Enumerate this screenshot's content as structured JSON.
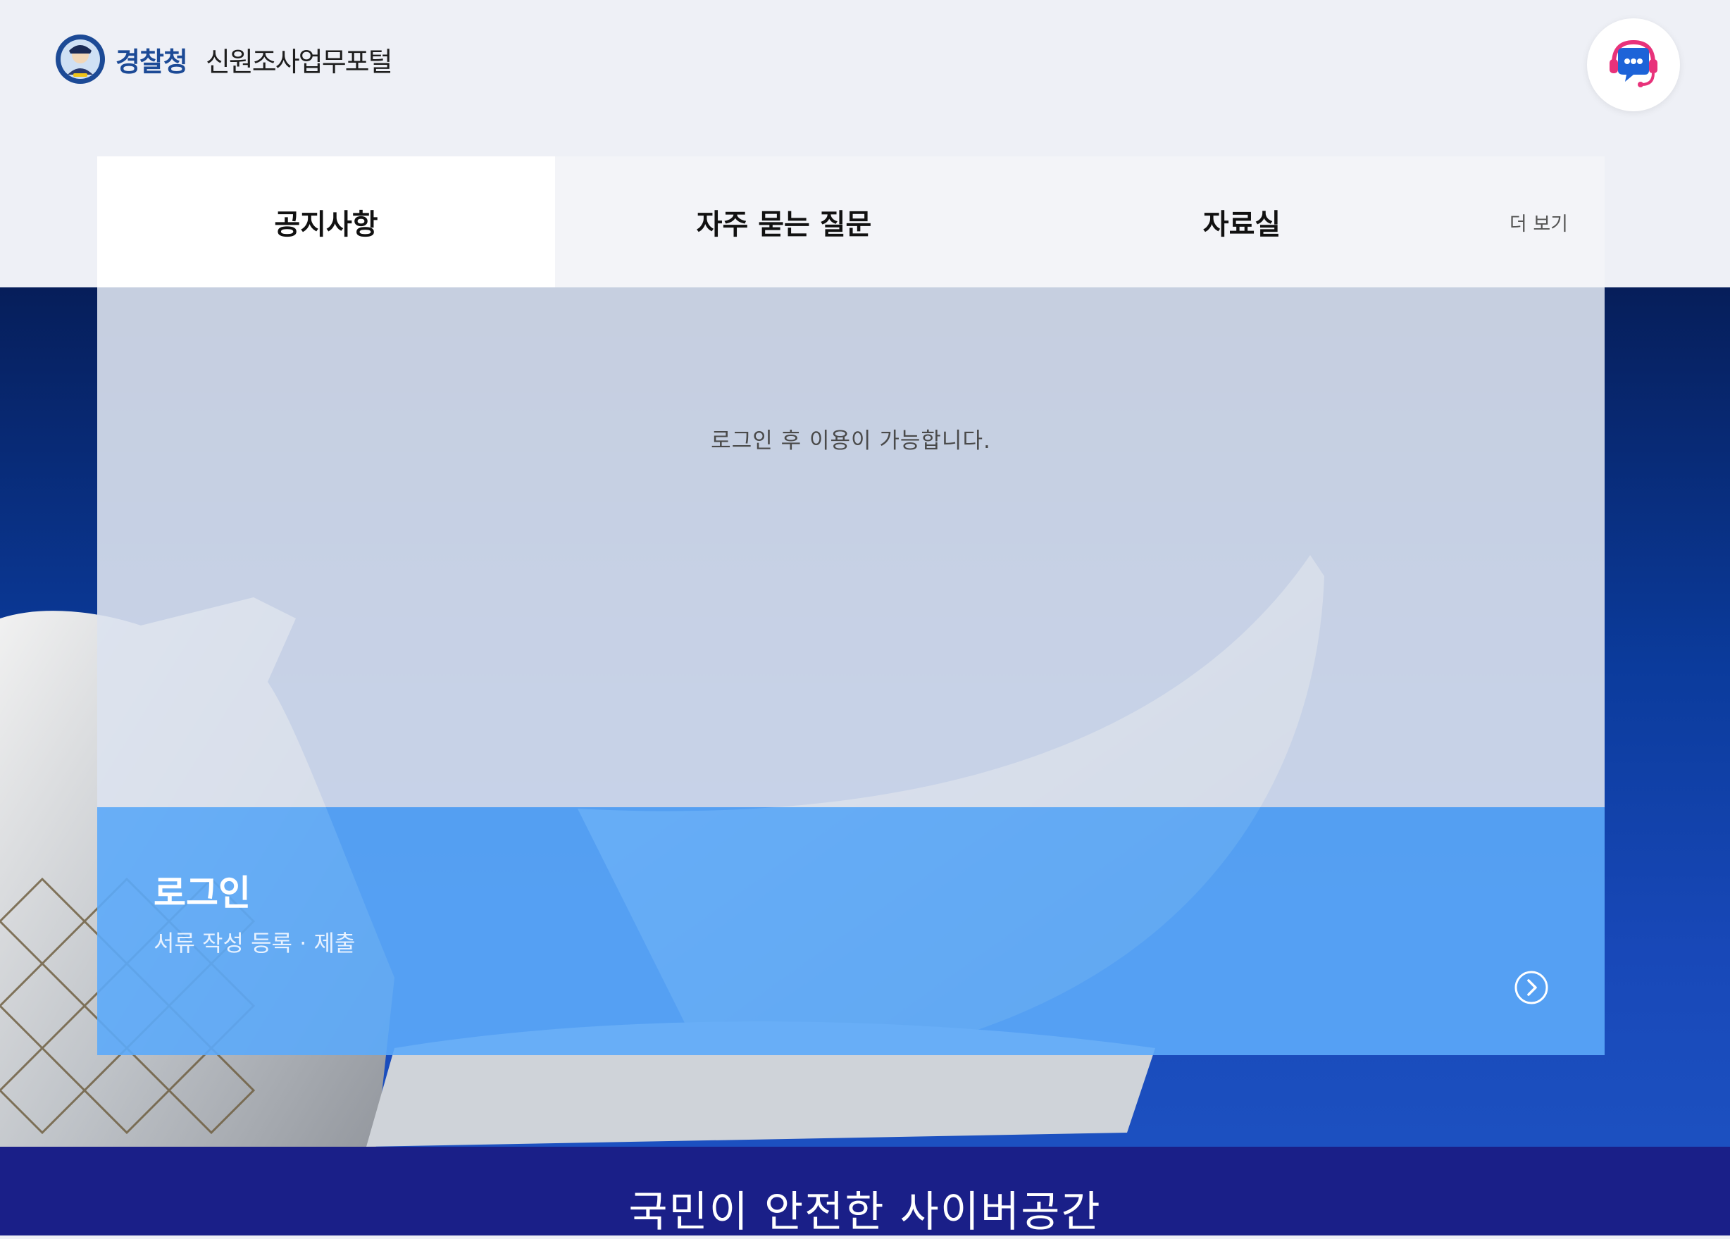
{
  "header": {
    "agency_name": "경찰청",
    "portal_name": "신원조사업무포털",
    "chatbot_icon": "chatbot-headset-icon"
  },
  "board": {
    "tabs": [
      {
        "label": "공지사항",
        "active": true
      },
      {
        "label": "자주 묻는 질문",
        "active": false
      },
      {
        "label": "자료실",
        "active": false
      }
    ],
    "more_label": "더 보기",
    "message": "로그인 후 이용이 가능합니다."
  },
  "login": {
    "title": "로그인",
    "subtitle": "서류 작성 등록 · 제출",
    "arrow_icon": "chevron-right-circle-icon"
  },
  "footer": {
    "slogan": "국민이 안전한 사이버공간"
  },
  "colors": {
    "brand_navy": "#1a1f88",
    "login_blue": "#5caafa",
    "agency_text": "#1c4a96"
  }
}
